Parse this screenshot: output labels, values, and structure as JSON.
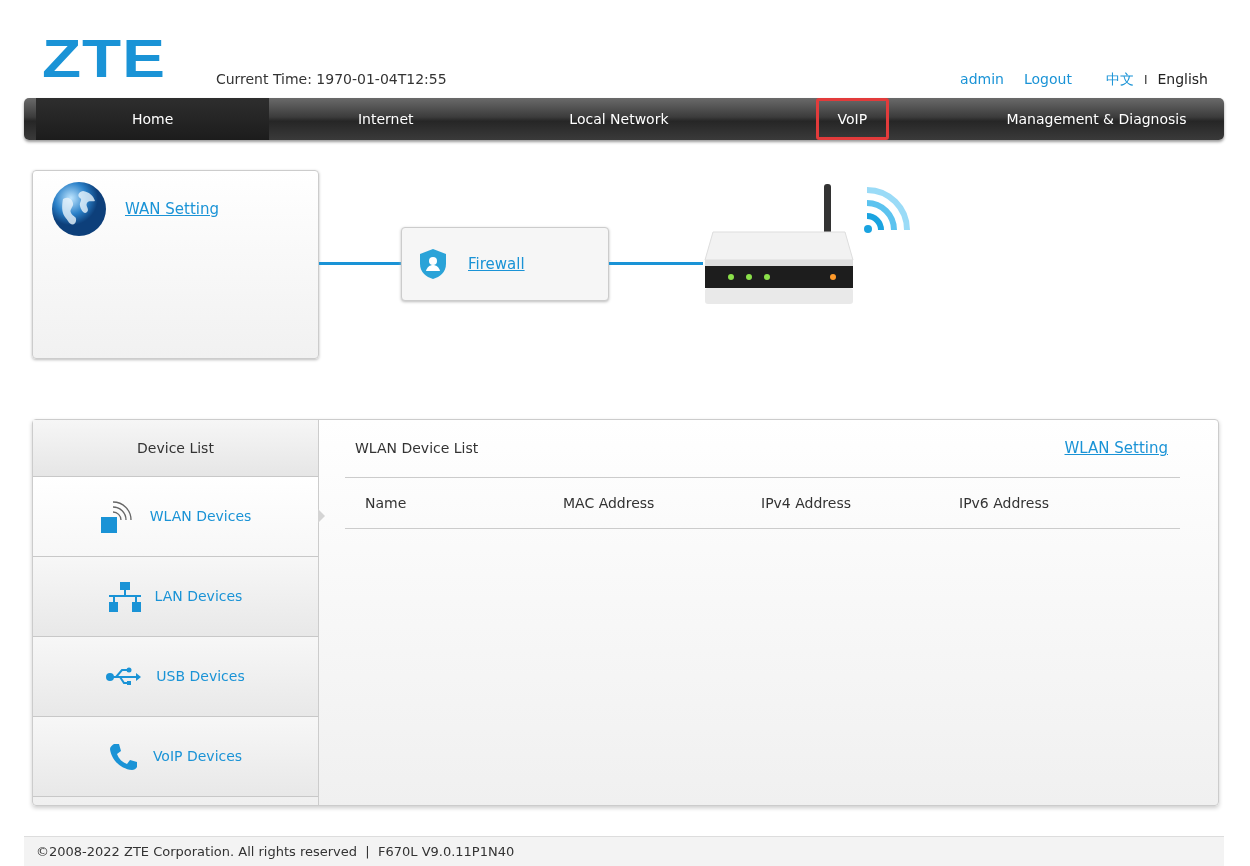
{
  "header": {
    "logo": "ZTE",
    "current_time": "Current Time: 1970-01-04T12:55",
    "user": "admin",
    "logout": "Logout",
    "separator": "I",
    "languages": [
      {
        "label": "中文",
        "selected": false
      },
      {
        "label": "English",
        "selected": true
      }
    ]
  },
  "nav": [
    {
      "label": "Home",
      "selected": true,
      "highlighted": false
    },
    {
      "label": "Internet",
      "selected": false,
      "highlighted": false
    },
    {
      "label": "Local Network",
      "selected": false,
      "highlighted": false
    },
    {
      "label": "VoIP",
      "selected": false,
      "highlighted": true
    },
    {
      "label": "Management & Diagnosis",
      "selected": false,
      "highlighted": false
    }
  ],
  "topology": {
    "wan_link": "WAN Setting",
    "firewall_link": "Firewall"
  },
  "device_list": {
    "title": "Device List",
    "items": [
      {
        "label": "WLAN Devices",
        "kind": "wlan",
        "selected": true
      },
      {
        "label": "LAN Devices",
        "kind": "lan",
        "selected": false
      },
      {
        "label": "USB Devices",
        "kind": "usb",
        "selected": false
      },
      {
        "label": "VoIP Devices",
        "kind": "voip",
        "selected": false
      }
    ],
    "panel_title": "WLAN Device List",
    "panel_link": "WLAN Setting",
    "columns": [
      "Name",
      "MAC Address",
      "IPv4 Address",
      "IPv6 Address"
    ]
  },
  "footer": "©2008-2022 ZTE Corporation. All rights reserved  |  F670L V9.0.11P1N40"
}
